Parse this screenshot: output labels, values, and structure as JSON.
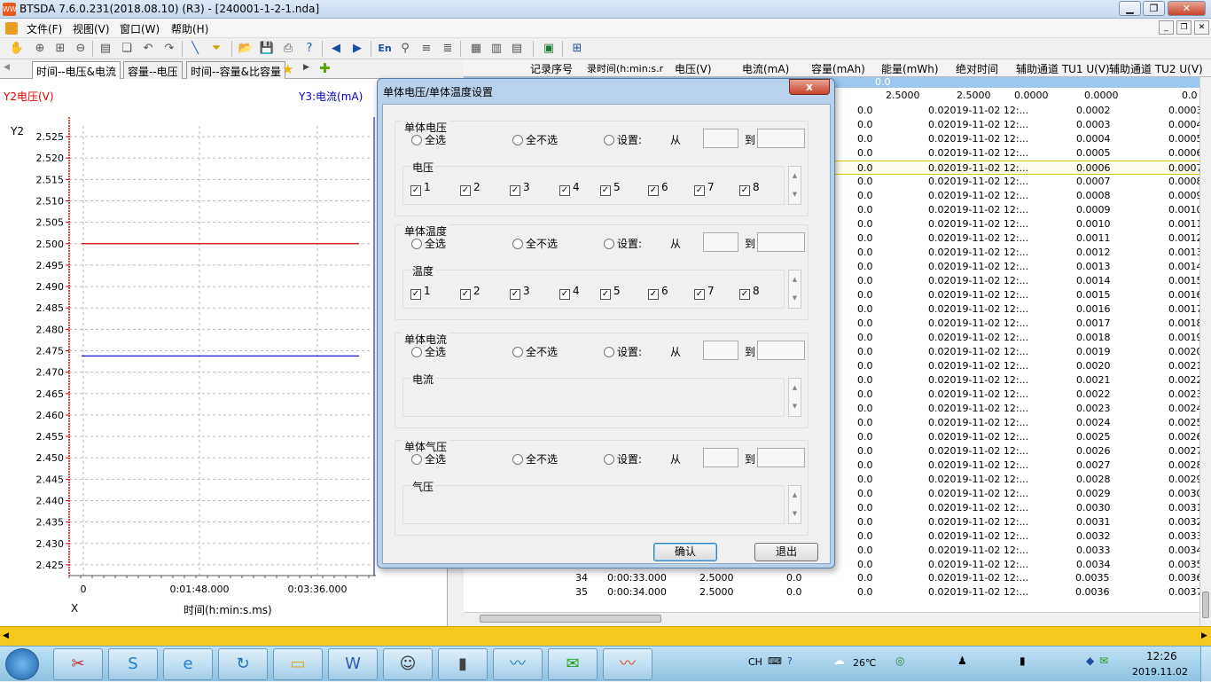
{
  "window": {
    "title": "BTSDA 7.6.0.231(2018.08.10) (R3) - [240001-1-2-1.nda]",
    "app_icon": "btsda-app-icon"
  },
  "menu": {
    "items": [
      "文件(F)",
      "视图(V)",
      "窗口(W)",
      "帮助(H)"
    ]
  },
  "toolbar": {
    "lang_label": "En"
  },
  "tabs": [
    "时间--电压&电流",
    "容量--电压",
    "时间--容量&比容量"
  ],
  "chart_data": {
    "type": "line",
    "left_axis_title": "Y2电压(V)",
    "right_axis_title": "Y3:电流(mA)",
    "y_axis_tag": "Y2",
    "x_axis_tag": "X",
    "xlabel": "时间(h:min:s.ms)",
    "x_ticks": [
      "0",
      "0:01:48.000",
      "0:03:36.000"
    ],
    "y_ticks": [
      "2.525",
      "2.520",
      "2.515",
      "2.510",
      "2.505",
      "2.500",
      "2.495",
      "2.490",
      "2.485",
      "2.480",
      "2.475",
      "2.470",
      "2.465",
      "2.460",
      "2.455",
      "2.450",
      "2.445",
      "2.440",
      "2.435",
      "2.430",
      "2.425"
    ],
    "ylim": [
      2.4225,
      2.5275
    ],
    "series": [
      {
        "color": "#d40000",
        "y": 2.5
      },
      {
        "color": "#0000c8",
        "y": 2.4738
      }
    ],
    "grid": true
  },
  "grid": {
    "columns": [
      "记录序号",
      "录时间(h:min:s.r",
      "电压(V)",
      "电流(mA)",
      "容量(mAh)",
      "能量(mWh)",
      "绝对时间",
      "辅助通道 TU1 U(V)",
      "辅助通道 TU2 U(V)"
    ],
    "filter_value": "0.0",
    "top_row": [
      "2.5000",
      "2.5000",
      "0.0000",
      "0.0000",
      "0.0"
    ],
    "rows": [
      {
        "tu1": "0.0002",
        "tu2": "0.0003"
      },
      {
        "tu1": "0.0003",
        "tu2": "0.0004"
      },
      {
        "tu1": "0.0004",
        "tu2": "0.0005"
      },
      {
        "tu1": "0.0005",
        "tu2": "0.0006"
      },
      {
        "tu1": "0.0006",
        "tu2": "0.0007"
      },
      {
        "tu1": "0.0007",
        "tu2": "0.0008"
      },
      {
        "tu1": "0.0008",
        "tu2": "0.0009"
      },
      {
        "tu1": "0.0009",
        "tu2": "0.0010"
      },
      {
        "tu1": "0.0010",
        "tu2": "0.0011"
      },
      {
        "tu1": "0.0011",
        "tu2": "0.0012"
      },
      {
        "tu1": "0.0012",
        "tu2": "0.0013"
      },
      {
        "tu1": "0.0013",
        "tu2": "0.0014"
      },
      {
        "tu1": "0.0014",
        "tu2": "0.0015"
      },
      {
        "tu1": "0.0015",
        "tu2": "0.0016"
      },
      {
        "tu1": "0.0016",
        "tu2": "0.0017"
      },
      {
        "tu1": "0.0017",
        "tu2": "0.0018"
      },
      {
        "tu1": "0.0018",
        "tu2": "0.0019"
      },
      {
        "tu1": "0.0019",
        "tu2": "0.0020"
      },
      {
        "tu1": "0.0020",
        "tu2": "0.0021"
      },
      {
        "tu1": "0.0021",
        "tu2": "0.0022"
      },
      {
        "tu1": "0.0022",
        "tu2": "0.0023"
      },
      {
        "tu1": "0.0023",
        "tu2": "0.0024"
      },
      {
        "tu1": "0.0024",
        "tu2": "0.0025"
      },
      {
        "tu1": "0.0025",
        "tu2": "0.0026"
      },
      {
        "tu1": "0.0026",
        "tu2": "0.0027"
      },
      {
        "tu1": "0.0027",
        "tu2": "0.0028"
      },
      {
        "tu1": "0.0028",
        "tu2": "0.0029"
      },
      {
        "tu1": "0.0029",
        "tu2": "0.0030"
      },
      {
        "tu1": "0.0030",
        "tu2": "0.0031"
      },
      {
        "tu1": "0.0031",
        "tu2": "0.0032"
      },
      {
        "tu1": "0.0032",
        "tu2": "0.0033"
      },
      {
        "tu1": "0.0033",
        "tu2": "0.0034"
      },
      {
        "tu1": "0.0034",
        "tu2": "0.0035"
      }
    ],
    "row_capacity": "0.0",
    "row_energy_abs": "0.02019-11-02 12:...",
    "bottom_rows": [
      {
        "no": "34",
        "time": "0:00:33.000",
        "volt": "2.5000",
        "cur": "0.0",
        "cap": "0.0",
        "abs": "0.02019-11-02 12:...",
        "tu1": "0.0035",
        "tu2": "0.0036"
      },
      {
        "no": "35",
        "time": "0:00:34.000",
        "volt": "2.5000",
        "cur": "0.0",
        "cap": "0.0",
        "abs": "0.02019-11-02 12:...",
        "tu1": "0.0036",
        "tu2": "0.0037"
      }
    ],
    "highlight_row_index": 4
  },
  "dialog": {
    "title": "单体电压/单体温度设置",
    "close_label": "x",
    "select_all": "全选",
    "select_none": "全不选",
    "set_label": "设置:",
    "from_label": "从",
    "to_label": "到",
    "sections": [
      {
        "title": "单体电压",
        "sub_title": "电压",
        "checks": [
          "1",
          "2",
          "3",
          "4",
          "5",
          "6",
          "7",
          "8"
        ]
      },
      {
        "title": "单体温度",
        "sub_title": "温度",
        "checks": [
          "1",
          "2",
          "3",
          "4",
          "5",
          "6",
          "7",
          "8"
        ]
      },
      {
        "title": "单体电流",
        "sub_title": "电流",
        "checks": []
      },
      {
        "title": "单体气压",
        "sub_title": "气压",
        "checks": []
      }
    ],
    "ok_label": "确认",
    "exit_label": "退出"
  },
  "taskbar": {
    "lang": "CH",
    "weather": "26℃",
    "time": "12:26",
    "date": "2019.11.02"
  }
}
